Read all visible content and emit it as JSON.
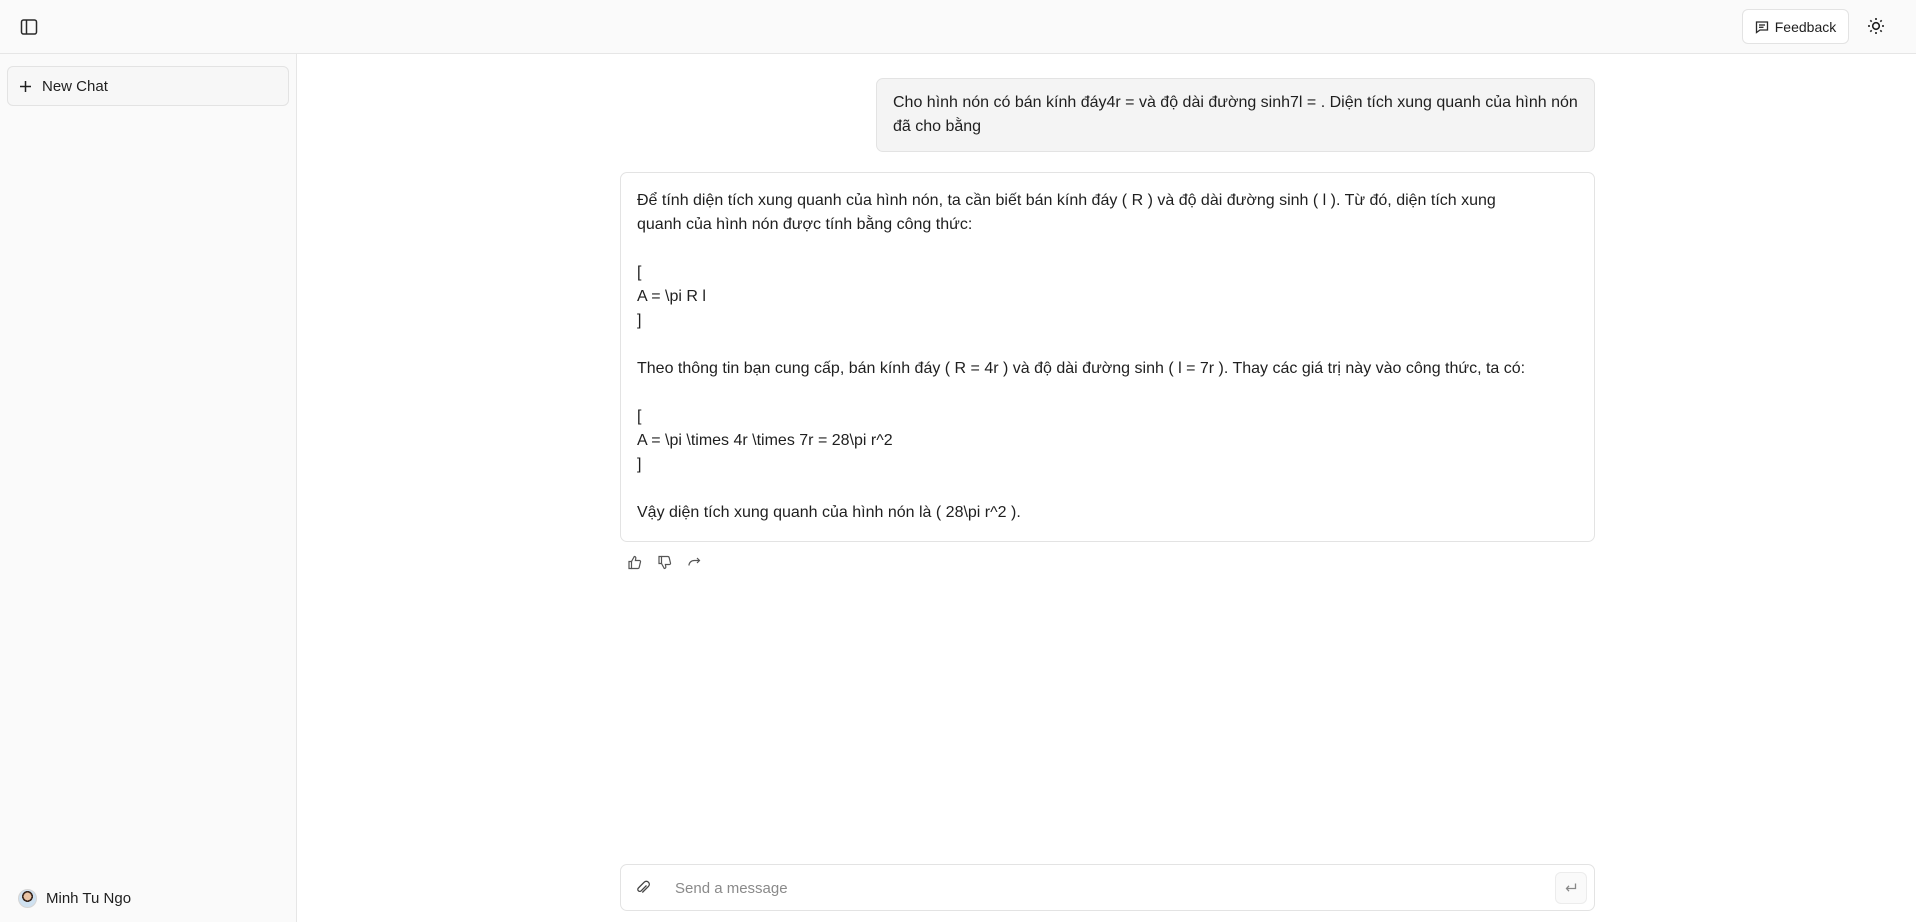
{
  "header": {
    "sidebar_toggle_icon": "sidebar-panel-icon",
    "feedback_label": "Feedback",
    "feedback_icon": "message-square-icon",
    "theme_icon": "sun-icon"
  },
  "sidebar": {
    "new_chat_label": "New Chat",
    "new_chat_icon": "plus-icon",
    "user_name": "Minh Tu Ngo"
  },
  "conversation": {
    "user_message": "Cho hình nón có bán kính đáy4r = và độ dài đường sinh7l = . Diện tích xung quanh của hình nón đã cho bằng",
    "assistant_lines": [
      "Để tính diện tích xung quanh của hình nón, ta cần biết bán kính đáy ( R ) và độ dài đường sinh ( l ). Từ đó, diện tích xung",
      "quanh của hình nón được tính bằng công thức:",
      "",
      "[",
      "A = \\pi R l",
      "]",
      "",
      "Theo thông tin bạn cung cấp, bán kính đáy ( R = 4r ) và độ dài đường sinh ( l = 7r ). Thay các giá trị này vào công thức, ta có:",
      "",
      "[",
      "A = \\pi \\times 4r \\times 7r = 28\\pi r^2",
      "]",
      "",
      "Vậy diện tích xung quanh của hình nón là ( 28\\pi r^2 )."
    ],
    "actions": [
      "thumbs-up-icon",
      "thumbs-down-icon",
      "redo-icon"
    ]
  },
  "composer": {
    "placeholder": "Send a message",
    "value": "",
    "attach_icon": "paperclip-icon",
    "send_icon": "enter-return-icon"
  },
  "colors": {
    "background": "#ffffff",
    "panel": "#fafafa",
    "border": "#e3e3e3",
    "user_bubble": "#f4f4f4",
    "text": "#1f1f1f",
    "muted": "#8a8a8a"
  }
}
